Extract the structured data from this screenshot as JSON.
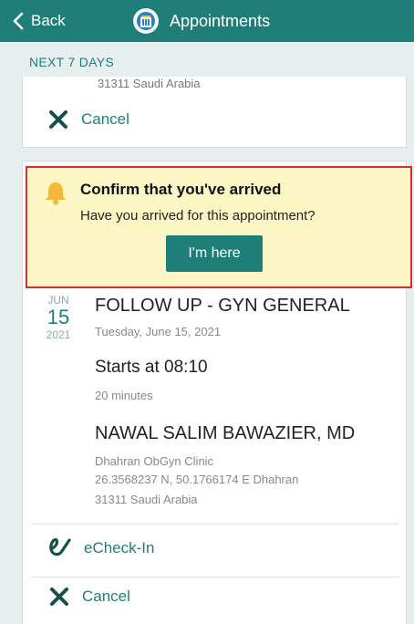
{
  "topbar": {
    "back_label": "Back",
    "title": "Appointments"
  },
  "section": {
    "header": "NEXT 7 DAYS"
  },
  "previous_card": {
    "address_tail": "31311 Saudi Arabia",
    "cancel_label": "Cancel"
  },
  "banner": {
    "title": "Confirm that you've arrived",
    "message": "Have you arrived for this appointment?",
    "button_label": "I'm here"
  },
  "appointment": {
    "month": "JUN",
    "day": "15",
    "year": "2021",
    "title": "FOLLOW UP - GYN GENERAL",
    "date_text": "Tuesday, June 15, 2021",
    "starts": "Starts at 08:10",
    "duration": "20 minutes",
    "provider": "NAWAL SALIM BAWAZIER, MD",
    "clinic_lines": [
      "Dhahran ObGyn Clinic",
      "26.3568237 N, 50.1766174 E Dhahran",
      "31311 Saudi Arabia"
    ],
    "echeckin_label": "eCheck-In",
    "cancel_label": "Cancel"
  },
  "colors": {
    "brand": "#1f7f78",
    "banner_bg": "#fbf6c4",
    "highlight_border": "#d32f3b",
    "bell": "#f5b93a"
  },
  "icons": {
    "back": "chevron-left-icon",
    "app": "hospital-icon",
    "bell": "bell-icon",
    "cancel": "close-icon",
    "echeckin": "echeck-icon"
  }
}
